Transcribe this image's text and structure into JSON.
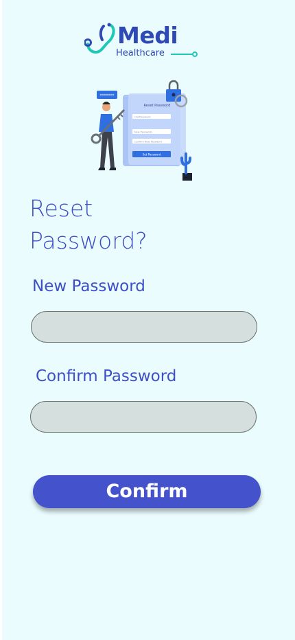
{
  "logo": {
    "name": "Medi",
    "tagline": "Healthcare"
  },
  "illustration": {
    "card_title": "Reset Password",
    "fields": [
      "Old Password",
      "New Password",
      "Confirm New Password"
    ],
    "button": "Set Password",
    "bubble": "*******"
  },
  "page": {
    "title_line1": "Reset",
    "title_line2": "Password?"
  },
  "form": {
    "new_password_label": "New Password",
    "new_password_value": "",
    "confirm_password_label": "Confirm Password",
    "confirm_password_value": "",
    "submit_label": "Confirm"
  },
  "colors": {
    "background": "#eafcfd",
    "accent": "#4452cc",
    "text": "#3e4ec7",
    "field": "#d5dfde",
    "logo_line": "#1fc8b5"
  }
}
